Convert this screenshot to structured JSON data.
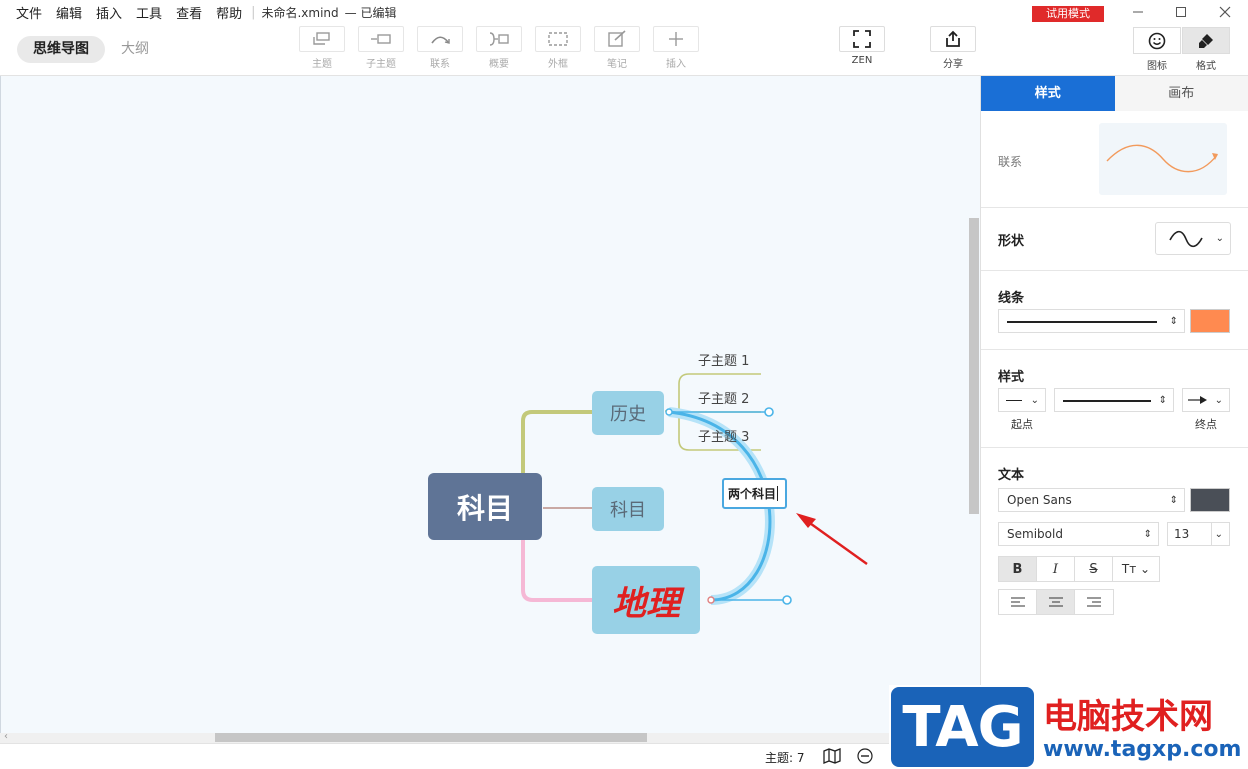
{
  "menu": [
    "文件",
    "编辑",
    "插入",
    "工具",
    "查看",
    "帮助"
  ],
  "document": {
    "name": "未命名.xmind",
    "status": "— 已编辑"
  },
  "trial_badge": "试用模式",
  "view_tabs": {
    "mindmap": "思维导图",
    "outline": "大纲"
  },
  "tools": {
    "topic": "主题",
    "subtopic": "子主题",
    "relationship": "联系",
    "summary": "概要",
    "boundary": "外框",
    "note": "笔记",
    "insert": "插入",
    "zen": "ZEN",
    "share": "分享",
    "icon": "图标",
    "format": "格式"
  },
  "map": {
    "root": "科目",
    "topics": [
      "历史",
      "科目",
      "地理"
    ],
    "subtopics": [
      "子主题 1",
      "子主题 2",
      "子主题 3"
    ],
    "relationship_label": "两个科目"
  },
  "panel": {
    "tabs": [
      "样式",
      "画布"
    ],
    "relationship_label": "联系",
    "shape": {
      "title": "形状",
      "value": "curve"
    },
    "line": {
      "title": "线条",
      "color": "#ff8a50"
    },
    "style": {
      "title": "样式",
      "start_label": "起点",
      "end_label": "终点"
    },
    "text": {
      "title": "文本",
      "font": "Open Sans",
      "weight": "Semibold",
      "size": "13",
      "color": "#4a4f57"
    }
  },
  "status": {
    "topic_count": "主题: 7"
  },
  "watermark": {
    "logo": "TAG",
    "site": "电脑技术网",
    "url": "www.tagxp.com"
  },
  "colors": {
    "accent": "#1a6fd6",
    "root_fill": "#5f7496",
    "topic_fill": "#98d1e6",
    "relationship_line": "#4ab4e8",
    "trial_red": "#e02a2a"
  }
}
